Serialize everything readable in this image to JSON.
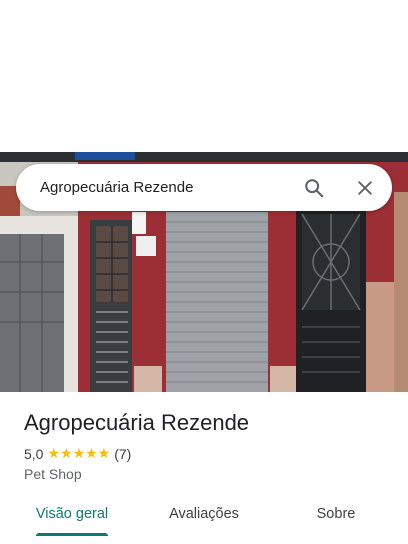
{
  "search": {
    "query": "Agropecuária Rezende"
  },
  "icons": {
    "search": "search-icon",
    "close": "close-icon",
    "star": "star-icon"
  },
  "place": {
    "name": "Agropecuária Rezende",
    "rating": "5,0",
    "stars": "★★★★★",
    "review_count": "(7)",
    "category": "Pet Shop"
  },
  "tabs": [
    {
      "label": "Visão geral",
      "active": true
    },
    {
      "label": "Avaliações",
      "active": false
    },
    {
      "label": "Sobre",
      "active": false
    }
  ],
  "colors": {
    "accent": "#0b7a75",
    "star": "#fbbc04",
    "wall_red": "#9b2f35"
  }
}
